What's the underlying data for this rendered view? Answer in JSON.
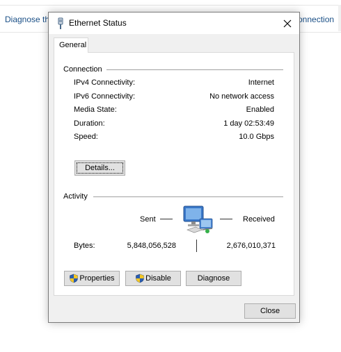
{
  "background": {
    "left_text": "Diagnose th",
    "right_text": "onnection"
  },
  "dialog": {
    "title": "Ethernet Status",
    "close_glyph": "×",
    "tab": "General"
  },
  "connection": {
    "label": "Connection",
    "rows": [
      {
        "label": "IPv4 Connectivity:",
        "value": "Internet"
      },
      {
        "label": "IPv6 Connectivity:",
        "value": "No network access"
      },
      {
        "label": "Media State:",
        "value": "Enabled"
      },
      {
        "label": "Duration:",
        "value": "1 day 02:53:49"
      },
      {
        "label": "Speed:",
        "value": "10.0 Gbps"
      }
    ],
    "details_button": "Details..."
  },
  "activity": {
    "label": "Activity",
    "sent_label": "Sent",
    "received_label": "Received",
    "bytes_label": "Bytes:",
    "bytes_sent": "5,848,056,528",
    "bytes_received": "2,676,010,371"
  },
  "buttons": {
    "properties": "Properties",
    "disable": "Disable",
    "diagnose": "Diagnose",
    "close": "Close"
  },
  "colors": {
    "link_blue": "#1a4f86",
    "dialog_bg": "#f0f0f0",
    "button_bg": "#e1e1e1"
  },
  "icons": {
    "title": "network-adapter-icon",
    "activity": "network-computers-icon",
    "shield": "uac-shield-icon"
  }
}
